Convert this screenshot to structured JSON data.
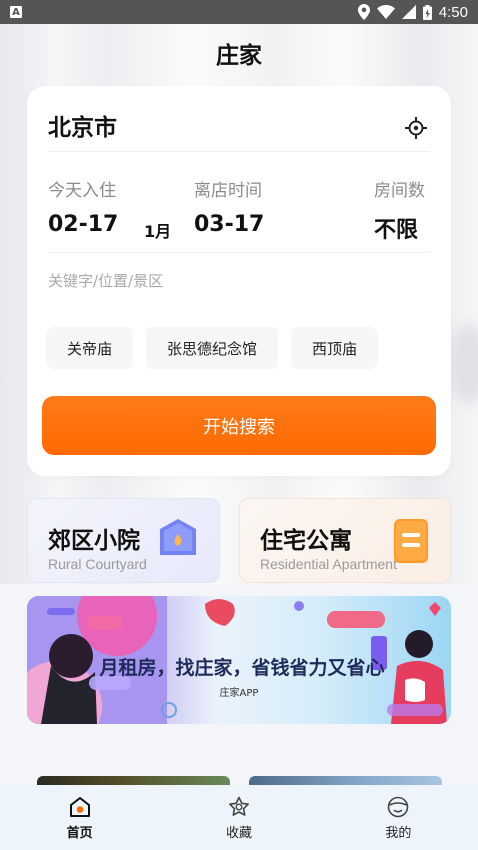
{
  "status_bar": {
    "time": "4:50",
    "app_badge": "A"
  },
  "header": {
    "title": "庄家"
  },
  "search": {
    "city": "北京市",
    "checkin_label": "今天入住",
    "checkin_date": "02-17",
    "month": "1月",
    "checkout_label": "离店时间",
    "checkout_date": "03-17",
    "rooms_label": "房间数",
    "rooms_value": "不限",
    "keyword_placeholder": "关键字/位置/景区",
    "tags": [
      "关帝庙",
      "张思德纪念馆",
      "西顶庙"
    ],
    "button_label": "开始搜索"
  },
  "categories": [
    {
      "title": "郊区小院",
      "subtitle": "Rural Courtyard",
      "icon": "house-icon"
    },
    {
      "title": "住宅公寓",
      "subtitle": "Residential Apartment",
      "icon": "apartment-icon"
    }
  ],
  "banner": {
    "headline": "月租房，找庄家，省钱省力又省心",
    "tagline": "庄家APP"
  },
  "tabs": [
    {
      "label": "首页",
      "icon": "home-icon",
      "active": true
    },
    {
      "label": "收藏",
      "icon": "star-icon",
      "active": false
    },
    {
      "label": "我的",
      "icon": "profile-icon",
      "active": false
    }
  ],
  "colors": {
    "accent": "#ff6a00",
    "tab_bar": "#eef4fb",
    "rural_icon": "#6f7cf2",
    "apartment_icon": "#ff8a1f"
  }
}
